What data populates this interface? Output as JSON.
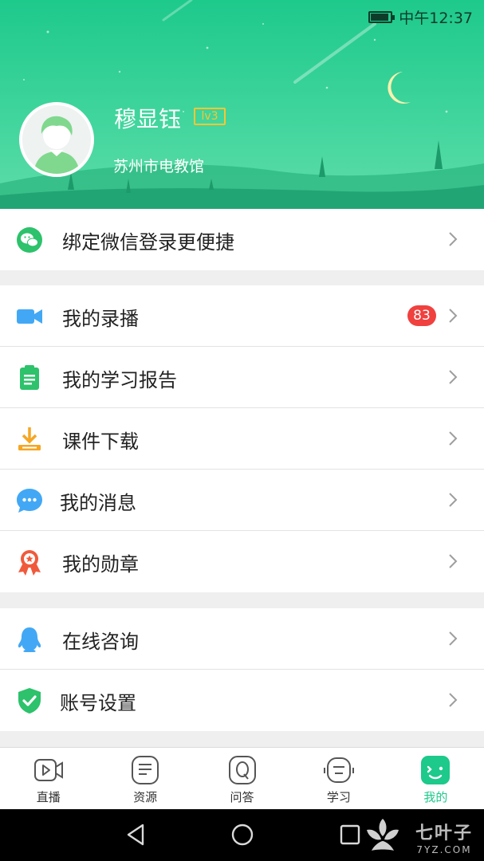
{
  "status_bar": {
    "time": "中午12:37",
    "battery_level": 0.9
  },
  "profile": {
    "name": "穆显钰",
    "level": "lv3",
    "organization": "苏州市电教馆"
  },
  "bind_row": {
    "label": "绑定微信登录更便捷",
    "icon": "wechat-icon"
  },
  "menu_group_1": [
    {
      "label": "我的录播",
      "icon": "video-camera-icon",
      "badge": "83"
    },
    {
      "label": "我的学习报告",
      "icon": "clipboard-report-icon"
    },
    {
      "label": "课件下载",
      "icon": "download-tray-icon"
    },
    {
      "label": "我的消息",
      "icon": "chat-bubble-icon"
    },
    {
      "label": "我的勋章",
      "icon": "medal-icon"
    }
  ],
  "menu_group_2": [
    {
      "label": "在线咨询",
      "icon": "qq-penguin-icon"
    },
    {
      "label": "账号设置",
      "icon": "shield-check-icon"
    }
  ],
  "tabs": [
    {
      "label": "直播",
      "icon": "live-play-icon",
      "active": false
    },
    {
      "label": "资源",
      "icon": "document-icon",
      "active": false
    },
    {
      "label": "问答",
      "icon": "question-q-icon",
      "active": false
    },
    {
      "label": "学习",
      "icon": "robot-face-icon",
      "active": false
    },
    {
      "label": "我的",
      "icon": "smile-face-icon",
      "active": true
    }
  ],
  "watermark": {
    "name": "七叶子",
    "domain": "7YZ.COM"
  },
  "colors": {
    "brand_green": "#1dc98b",
    "badge_red": "#f0413f",
    "level_gold": "#f7c633",
    "icon_blue": "#42a8f5",
    "icon_orange": "#f5a623",
    "icon_red": "#f05a3c"
  }
}
